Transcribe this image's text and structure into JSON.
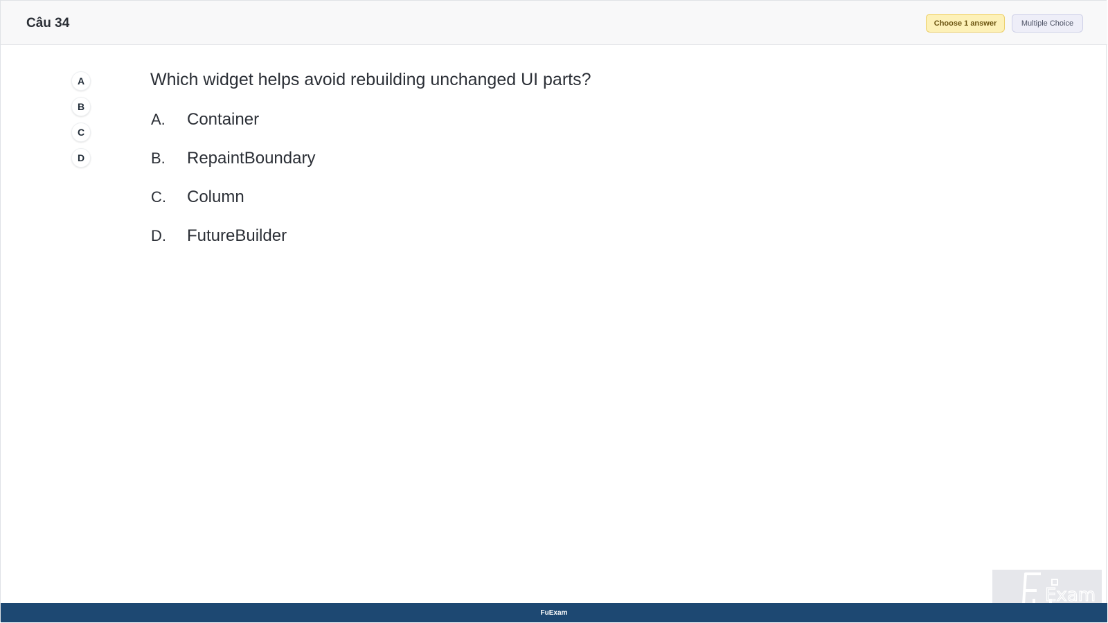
{
  "header": {
    "question_number": "Câu 34",
    "choose_badge": "Choose 1 answer",
    "type_badge": "Multiple Choice"
  },
  "side_options": [
    "A",
    "B",
    "C",
    "D"
  ],
  "question": {
    "text": "Which widget helps avoid rebuilding unchanged UI parts?",
    "answers": [
      {
        "letter": "A.",
        "text": "Container"
      },
      {
        "letter": "B.",
        "text": "RepaintBoundary"
      },
      {
        "letter": "C.",
        "text": "Column"
      },
      {
        "letter": "D.",
        "text": "FutureBuilder"
      }
    ]
  },
  "footer": {
    "label": "FuExam"
  },
  "logo": {
    "text": "FU Exam",
    "color": "#ffffff"
  },
  "colors": {
    "footer_bg": "#1d4872",
    "choose_badge_bg": "#fdf1b8",
    "type_badge_bg": "#eeeef8"
  }
}
